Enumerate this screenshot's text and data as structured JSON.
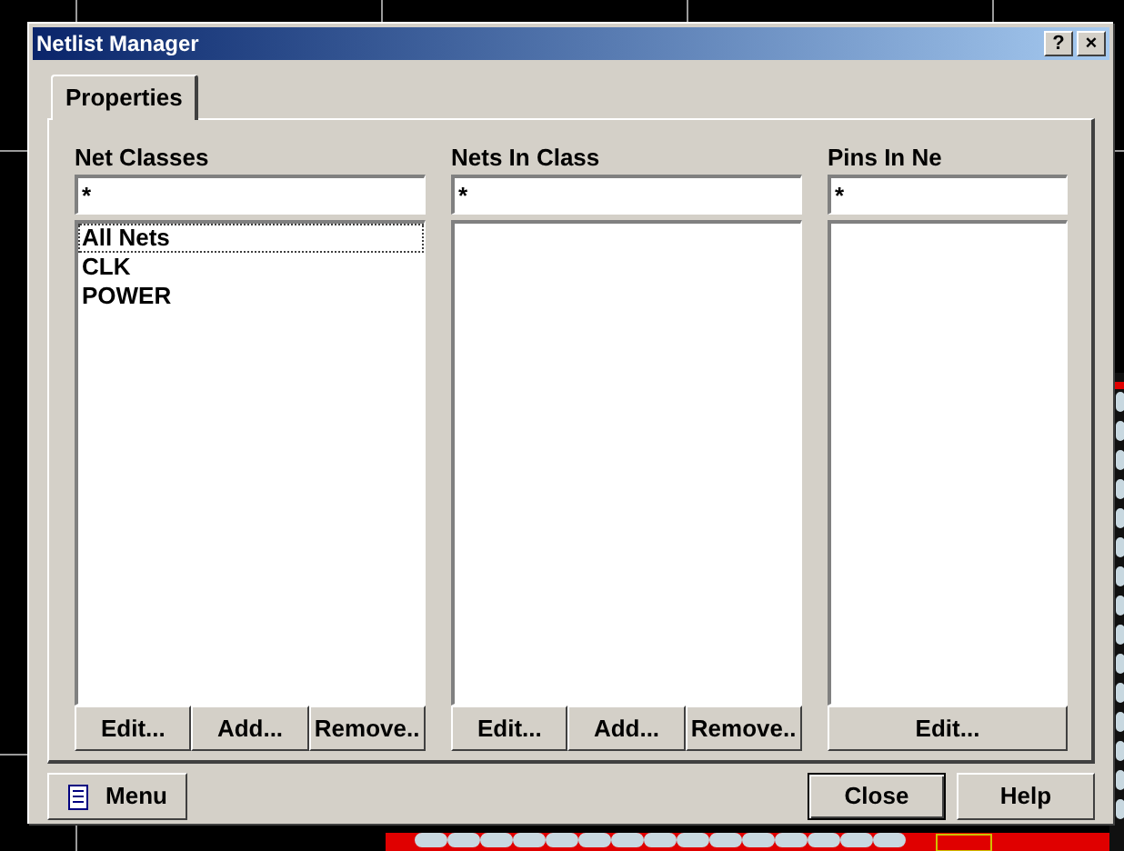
{
  "window": {
    "title": "Netlist Manager",
    "title_buttons": [
      "?",
      "×"
    ]
  },
  "tabs": [
    {
      "label": "Properties",
      "selected": true
    }
  ],
  "columns": [
    {
      "heading": "Net Classes",
      "filter": "*",
      "items": [
        {
          "label": "All Nets",
          "focused": true
        },
        {
          "label": "CLK",
          "focused": false
        },
        {
          "label": "POWER",
          "focused": false
        }
      ],
      "buttons": [
        "Edit...",
        "Add...",
        "Remove.."
      ]
    },
    {
      "heading": "Nets In Class",
      "filter": "*",
      "buttons": [
        "Edit...",
        "Add...",
        "Remove.."
      ]
    },
    {
      "heading": "Pins In Ne",
      "filter": "*",
      "buttons": [
        "Edit..."
      ]
    }
  ],
  "footer": {
    "menu_button": "Menu",
    "buttons": [
      "Close",
      "Help"
    ]
  }
}
